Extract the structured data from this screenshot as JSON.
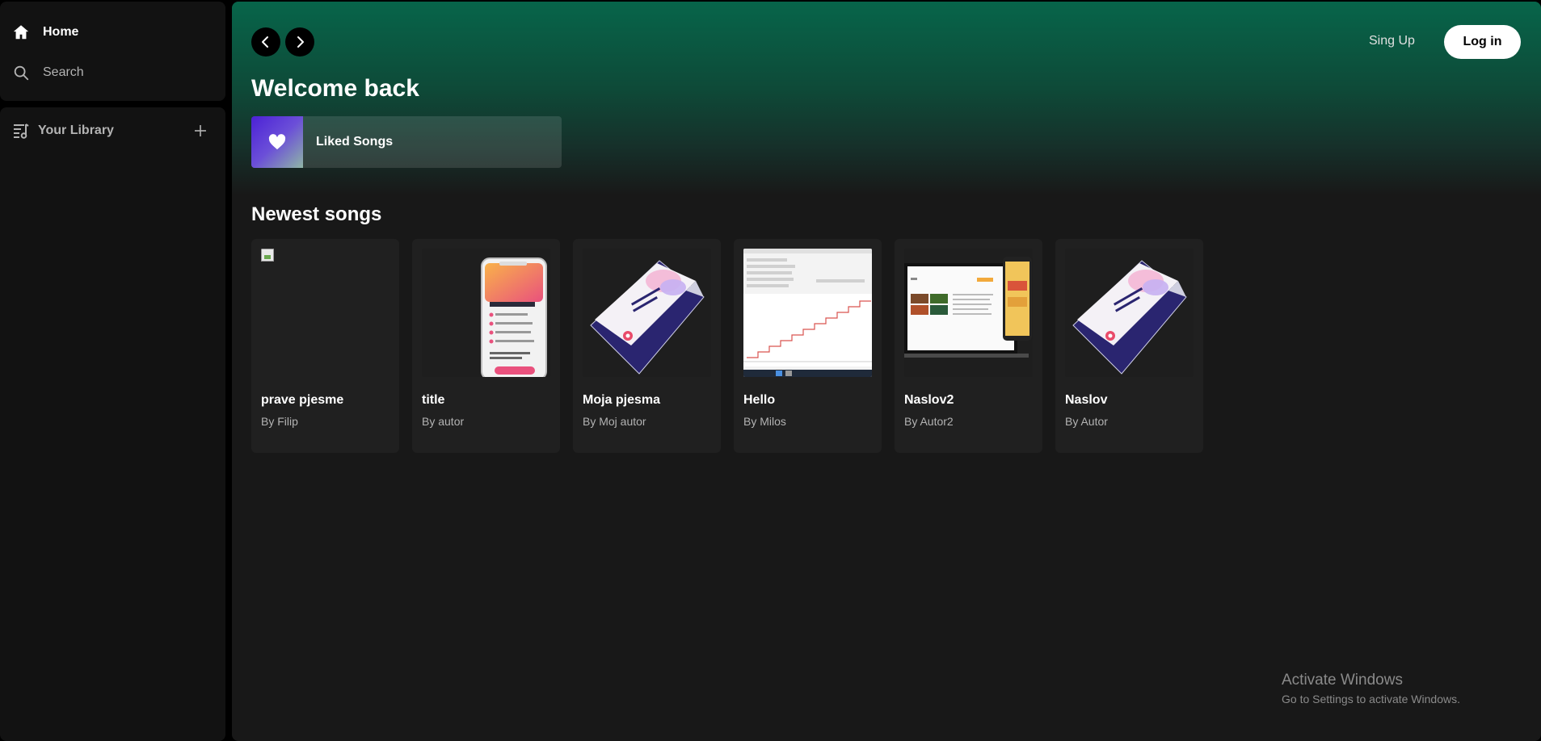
{
  "sidebar": {
    "home_label": "Home",
    "search_label": "Search",
    "library_label": "Your Library"
  },
  "header": {
    "signup_label": "Sing Up",
    "login_label": "Log in"
  },
  "main": {
    "welcome": "Welcome back",
    "liked_songs": "Liked Songs",
    "section_title": "Newest songs",
    "songs": [
      {
        "title": "prave pjesme",
        "author": "By Filip",
        "art": "broken-image"
      },
      {
        "title": "title",
        "author": "By autor",
        "art": "phone-mockup"
      },
      {
        "title": "Moja pjesma",
        "author": "By Moj autor",
        "art": "brochure"
      },
      {
        "title": "Hello",
        "author": "By Milos",
        "art": "screenshot-chart"
      },
      {
        "title": "Naslov2",
        "author": "By Autor2",
        "art": "laptop-mockup"
      },
      {
        "title": "Naslov",
        "author": "By Autor",
        "art": "brochure"
      }
    ]
  },
  "watermark": {
    "line1": "Activate Windows",
    "line2": "Go to Settings to activate Windows."
  },
  "colors": {
    "accent_green": "#07654a",
    "bg": "#121212",
    "card": "#202020"
  }
}
